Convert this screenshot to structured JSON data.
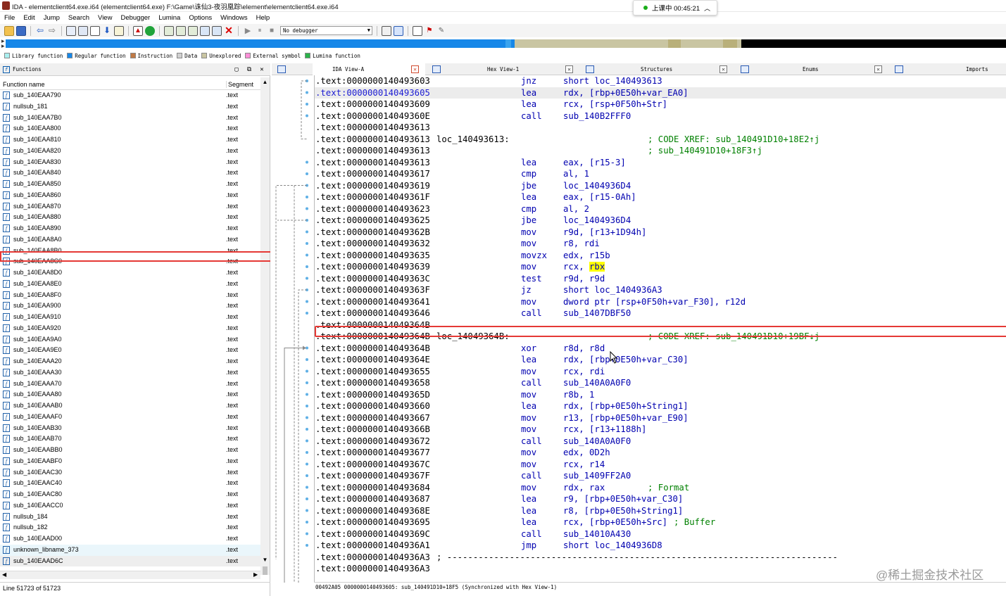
{
  "window": {
    "title": "IDA - elementclient64.exe.i64 (elementclient64.exe) F:\\Game\\诛仙3-夜羽凰踪\\element\\elementclient64.exe.i64",
    "status_text": "上课中 00:45:21",
    "status_icon": "chevron-up-icon"
  },
  "menu": [
    "File",
    "Edit",
    "Jump",
    "Search",
    "View",
    "Debugger",
    "Lumina",
    "Options",
    "Windows",
    "Help"
  ],
  "toolbar": {
    "debugger_select": "No debugger",
    "icons": [
      "open-icon",
      "save-icon",
      "back-icon",
      "forward-icon",
      "copy-icon",
      "paste-icon",
      "search-icon",
      "jump-icon",
      "graph-icon",
      "run-icon",
      "pause-icon",
      "stop-icon",
      "close-icon"
    ]
  },
  "legend": [
    {
      "label": "Library function",
      "color": "#00ffff"
    },
    {
      "label": "Regular function",
      "color": "#0a6ad6"
    },
    {
      "label": "Instruction",
      "color": "#b87333"
    },
    {
      "label": "Data",
      "color": "#c0c0c0"
    },
    {
      "label": "Unexplored",
      "color": "#b5b58a"
    },
    {
      "label": "External symbol",
      "color": "#ff7fd0"
    },
    {
      "label": "Lumina function",
      "color": "#22b14c"
    }
  ],
  "functions_panel": {
    "title": "Functions",
    "col_name": "Function name",
    "col_segment": "Segment",
    "status": "Line 51723 of 51723",
    "rows": [
      {
        "name": "sub_140EAA790",
        "seg": ".text"
      },
      {
        "name": "nullsub_181",
        "seg": ".text"
      },
      {
        "name": "sub_140EAA7B0",
        "seg": ".text"
      },
      {
        "name": "sub_140EAA800",
        "seg": ".text"
      },
      {
        "name": "sub_140EAA810",
        "seg": ".text"
      },
      {
        "name": "sub_140EAA820",
        "seg": ".text"
      },
      {
        "name": "sub_140EAA830",
        "seg": ".text"
      },
      {
        "name": "sub_140EAA840",
        "seg": ".text"
      },
      {
        "name": "sub_140EAA850",
        "seg": ".text"
      },
      {
        "name": "sub_140EAA860",
        "seg": ".text"
      },
      {
        "name": "sub_140EAA870",
        "seg": ".text"
      },
      {
        "name": "sub_140EAA880",
        "seg": ".text"
      },
      {
        "name": "sub_140EAA890",
        "seg": ".text"
      },
      {
        "name": "sub_140EAA8A0",
        "seg": ".text"
      },
      {
        "name": "sub_140EAA8B0",
        "seg": ".text"
      },
      {
        "name": "sub_140EAA8C0",
        "seg": ".text"
      },
      {
        "name": "sub_140EAA8D0",
        "seg": ".text"
      },
      {
        "name": "sub_140EAA8E0",
        "seg": ".text"
      },
      {
        "name": "sub_140EAA8F0",
        "seg": ".text"
      },
      {
        "name": "sub_140EAA900",
        "seg": ".text"
      },
      {
        "name": "sub_140EAA910",
        "seg": ".text"
      },
      {
        "name": "sub_140EAA920",
        "seg": ".text"
      },
      {
        "name": "sub_140EAA9A0",
        "seg": ".text"
      },
      {
        "name": "sub_140EAA9E0",
        "seg": ".text"
      },
      {
        "name": "sub_140EAAA20",
        "seg": ".text"
      },
      {
        "name": "sub_140EAAA30",
        "seg": ".text"
      },
      {
        "name": "sub_140EAAA70",
        "seg": ".text"
      },
      {
        "name": "sub_140EAAA80",
        "seg": ".text"
      },
      {
        "name": "sub_140EAAAB0",
        "seg": ".text"
      },
      {
        "name": "sub_140EAAAF0",
        "seg": ".text"
      },
      {
        "name": "sub_140EAAB30",
        "seg": ".text"
      },
      {
        "name": "sub_140EAAB70",
        "seg": ".text"
      },
      {
        "name": "sub_140EAABB0",
        "seg": ".text"
      },
      {
        "name": "sub_140EAABF0",
        "seg": ".text"
      },
      {
        "name": "sub_140EAAC30",
        "seg": ".text"
      },
      {
        "name": "sub_140EAAC40",
        "seg": ".text"
      },
      {
        "name": "sub_140EAAC80",
        "seg": ".text"
      },
      {
        "name": "sub_140EAACC0",
        "seg": ".text"
      },
      {
        "name": "nullsub_184",
        "seg": ".text"
      },
      {
        "name": "nullsub_182",
        "seg": ".text"
      },
      {
        "name": "sub_140EAAD00",
        "seg": ".text"
      },
      {
        "name": "unknown_libname_373",
        "seg": ".text"
      },
      {
        "name": "sub_140EAAD6C",
        "seg": ".text"
      }
    ]
  },
  "tabs": [
    {
      "label": "IDA View-A",
      "icon": "ida-view-icon"
    },
    {
      "label": "Hex View-1",
      "icon": "hex-view-icon"
    },
    {
      "label": "Structures",
      "icon": "structures-icon"
    },
    {
      "label": "Enums",
      "icon": "enums-icon"
    },
    {
      "label": "Imports",
      "icon": "imports-icon"
    }
  ],
  "disasm": {
    "lines": [
      {
        "addr": ".text:0000000140493603",
        "label": "",
        "mnem": "jnz",
        "ops": "short loc_140493613",
        "cmt": ""
      },
      {
        "addr": ".text:0000000140493605",
        "label": "",
        "mnem": "lea",
        "ops": "rdx, [rbp+0E50h+var_EA0]",
        "cmt": ""
      },
      {
        "addr": ".text:0000000140493609",
        "label": "",
        "mnem": "lea",
        "ops": "rcx, [rsp+0F50h+Str]",
        "cmt": ""
      },
      {
        "addr": ".text:000000014049360E",
        "label": "",
        "mnem": "call",
        "ops": "sub_140B2FFF0",
        "cmt": ""
      },
      {
        "addr": ".text:0000000140493613",
        "label": "",
        "mnem": "",
        "ops": "",
        "cmt": ""
      },
      {
        "addr": ".text:0000000140493613",
        "label": "loc_140493613:",
        "mnem": "",
        "ops": "",
        "cmt": "; CODE XREF: sub_140491D10+18E2↑j"
      },
      {
        "addr": ".text:0000000140493613",
        "label": "",
        "mnem": "",
        "ops": "",
        "cmt": "; sub_140491D10+18F3↑j"
      },
      {
        "addr": ".text:0000000140493613",
        "label": "",
        "mnem": "lea",
        "ops": "eax, [r15-3]",
        "cmt": ""
      },
      {
        "addr": ".text:0000000140493617",
        "label": "",
        "mnem": "cmp",
        "ops": "al, 1",
        "cmt": ""
      },
      {
        "addr": ".text:0000000140493619",
        "label": "",
        "mnem": "jbe",
        "ops": "loc_1404936D4",
        "cmt": ""
      },
      {
        "addr": ".text:000000014049361F",
        "label": "",
        "mnem": "lea",
        "ops": "eax, [r15-0Ah]",
        "cmt": ""
      },
      {
        "addr": ".text:0000000140493623",
        "label": "",
        "mnem": "cmp",
        "ops": "al, 2",
        "cmt": ""
      },
      {
        "addr": ".text:0000000140493625",
        "label": "",
        "mnem": "jbe",
        "ops": "loc_1404936D4",
        "cmt": ""
      },
      {
        "addr": ".text:000000014049362B",
        "label": "",
        "mnem": "mov",
        "ops": "r9d, [r13+1D94h]",
        "cmt": ""
      },
      {
        "addr": ".text:0000000140493632",
        "label": "",
        "mnem": "mov",
        "ops": "r8, rdi",
        "cmt": ""
      },
      {
        "addr": ".text:0000000140493635",
        "label": "",
        "mnem": "movzx",
        "ops": "edx, r15b",
        "cmt": ""
      },
      {
        "addr": ".text:0000000140493639",
        "label": "",
        "mnem": "mov",
        "ops": "rcx, rbx",
        "cmt": ""
      },
      {
        "addr": ".text:000000014049363C",
        "label": "",
        "mnem": "test",
        "ops": "r9d, r9d",
        "cmt": ""
      },
      {
        "addr": ".text:000000014049363F",
        "label": "",
        "mnem": "jz",
        "ops": "short loc_1404936A3",
        "cmt": ""
      },
      {
        "addr": ".text:0000000140493641",
        "label": "",
        "mnem": "mov",
        "ops": "dword ptr [rsp+0F50h+var_F30], r12d",
        "cmt": ""
      },
      {
        "addr": ".text:0000000140493646",
        "label": "",
        "mnem": "call",
        "ops": "sub_1407DBF50",
        "cmt": ""
      },
      {
        "addr": ".text:000000014049364B",
        "label": "",
        "mnem": "",
        "ops": "",
        "cmt": ""
      },
      {
        "addr": ".text:000000014049364B",
        "label": "loc_14049364B:",
        "mnem": "",
        "ops": "",
        "cmt": "; CODE XREF: sub_140491D10+19BF↓j"
      },
      {
        "addr": ".text:000000014049364B",
        "label": "",
        "mnem": "xor",
        "ops": "r8d, r8d",
        "cmt": ""
      },
      {
        "addr": ".text:000000014049364E",
        "label": "",
        "mnem": "lea",
        "ops": "rdx, [rbp+0E50h+var_C30]",
        "cmt": ""
      },
      {
        "addr": ".text:0000000140493655",
        "label": "",
        "mnem": "mov",
        "ops": "rcx, rdi",
        "cmt": ""
      },
      {
        "addr": ".text:0000000140493658",
        "label": "",
        "mnem": "call",
        "ops": "sub_140A0A0F0",
        "cmt": ""
      },
      {
        "addr": ".text:000000014049365D",
        "label": "",
        "mnem": "mov",
        "ops": "r8b, 1",
        "cmt": ""
      },
      {
        "addr": ".text:0000000140493660",
        "label": "",
        "mnem": "lea",
        "ops": "rdx, [rbp+0E50h+String1]",
        "cmt": ""
      },
      {
        "addr": ".text:0000000140493667",
        "label": "",
        "mnem": "mov",
        "ops": "r13, [rbp+0E50h+var_E90]",
        "cmt": ""
      },
      {
        "addr": ".text:000000014049366B",
        "label": "",
        "mnem": "mov",
        "ops": "rcx, [r13+1188h]",
        "cmt": ""
      },
      {
        "addr": ".text:0000000140493672",
        "label": "",
        "mnem": "call",
        "ops": "sub_140A0A0F0",
        "cmt": ""
      },
      {
        "addr": ".text:0000000140493677",
        "label": "",
        "mnem": "mov",
        "ops": "edx, 0D2h",
        "cmt": ""
      },
      {
        "addr": ".text:000000014049367C",
        "label": "",
        "mnem": "mov",
        "ops": "rcx, r14",
        "cmt": ""
      },
      {
        "addr": ".text:000000014049367F",
        "label": "",
        "mnem": "call",
        "ops": "sub_1409FF2A0",
        "cmt": ""
      },
      {
        "addr": ".text:0000000140493684",
        "label": "",
        "mnem": "mov",
        "ops": "rdx, rax",
        "cmt": "; Format"
      },
      {
        "addr": ".text:0000000140493687",
        "label": "",
        "mnem": "lea",
        "ops": "r9, [rbp+0E50h+var_C30]",
        "cmt": ""
      },
      {
        "addr": ".text:000000014049368E",
        "label": "",
        "mnem": "lea",
        "ops": "r8, [rbp+0E50h+String1]",
        "cmt": ""
      },
      {
        "addr": ".text:0000000140493695",
        "label": "",
        "mnem": "lea",
        "ops": "rcx, [rbp+0E50h+Src]",
        "cmt": "; Buffer"
      },
      {
        "addr": ".text:000000014049369C",
        "label": "",
        "mnem": "call",
        "ops": "sub_14010A430",
        "cmt": ""
      },
      {
        "addr": ".text:00000001404936A1",
        "label": "",
        "mnem": "jmp",
        "ops": "short loc_1404936D8",
        "cmt": ""
      },
      {
        "addr": ".text:00000001404936A3",
        "label": "; ---------------------------------------------------------------------------",
        "mnem": "",
        "ops": "",
        "cmt": ""
      },
      {
        "addr": ".text:00000001404936A3",
        "label": "",
        "mnem": "",
        "ops": "",
        "cmt": ""
      }
    ],
    "status": "00492A05 0000000140493605: sub_140491D10+18F5 (Synchronized with Hex View-1)"
  },
  "watermark": "@稀土掘金技术社区"
}
